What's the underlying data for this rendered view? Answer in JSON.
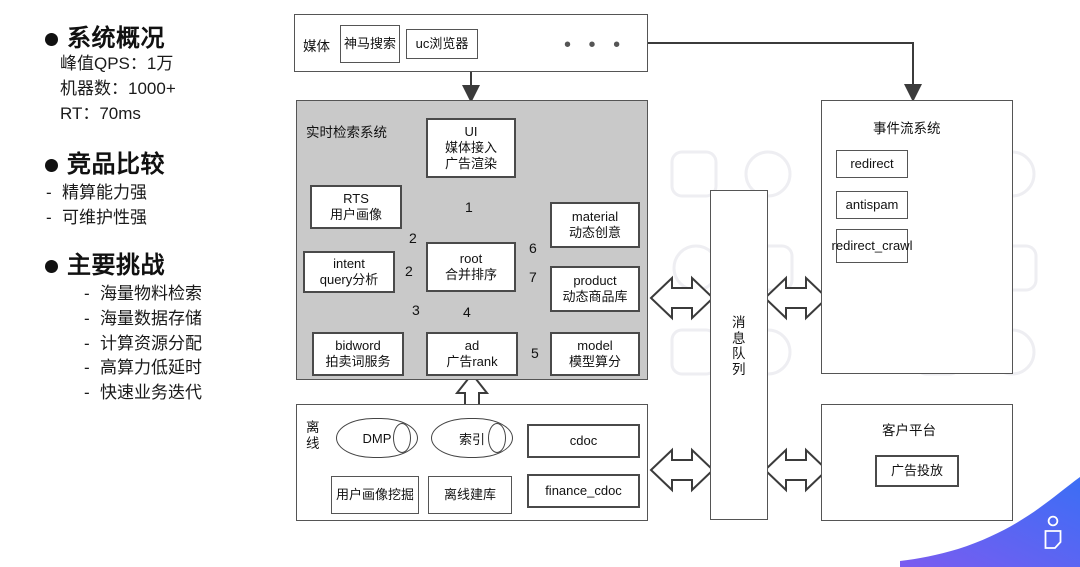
{
  "left_panel": {
    "sections": [
      {
        "title": "系统概况",
        "lines": [
          "峰值QPS：1万",
          "机器数：1000+",
          "RT：70ms"
        ],
        "bullets": []
      },
      {
        "title": "竞品比较",
        "lines": [],
        "bullets": [
          "精算能力强",
          "可维护性强"
        ]
      },
      {
        "title": "主要挑战",
        "lines": [],
        "bullets": [
          "海量物料检索",
          "海量数据存储",
          "计算资源分配",
          "高算力低延时",
          "快速业务迭代"
        ]
      }
    ]
  },
  "diagram": {
    "media_bar": {
      "label": "媒体",
      "items": [
        "神马搜索",
        "uc浏览器"
      ],
      "ellipsis": "• • •"
    },
    "retrieval_system": {
      "label": "实时检索系统",
      "nodes": {
        "ui": {
          "line1": "UI",
          "line2": "媒体接入",
          "line3": "广告渲染"
        },
        "rts": {
          "line1": "RTS",
          "line2": "用户画像"
        },
        "intent": {
          "line1": "intent",
          "line2": "query分析"
        },
        "root": {
          "line1": "root",
          "line2": "合并排序"
        },
        "material": {
          "line1": "material",
          "line2": "动态创意"
        },
        "product": {
          "line1": "product",
          "line2": "动态商品库"
        },
        "bidword": {
          "line1": "bidword",
          "line2": "拍卖词服务"
        },
        "ad": {
          "line1": "ad",
          "line2": "广告rank"
        },
        "model": {
          "line1": "model",
          "line2": "模型算分"
        }
      },
      "edge_numbers": {
        "ui_root": "1",
        "root_rts": "2",
        "root_intent": "2",
        "root_bidword": "3",
        "root_ad": "4",
        "ad_model": "5",
        "root_material": "6",
        "root_product": "7"
      }
    },
    "offline": {
      "label": "离线",
      "dmp": "DMP",
      "index": "索引",
      "dmp_source": "用户画像挖掘",
      "index_source": "离线建库",
      "cdoc": "cdoc",
      "finance_cdoc": "finance_cdoc"
    },
    "message_queue": {
      "label": "消息队列"
    },
    "event_stream": {
      "label": "事件流系统",
      "items": [
        "redirect",
        "antispam",
        "redirect_crawl"
      ]
    },
    "customer_platform": {
      "label": "客户平台",
      "items": [
        "广告投放"
      ]
    }
  },
  "colors": {
    "gray_panel": "#c9c9c9",
    "stroke": "#4a4a4a",
    "swoosh_start": "#7b5cf0",
    "swoosh_end": "#3b6ef5"
  }
}
